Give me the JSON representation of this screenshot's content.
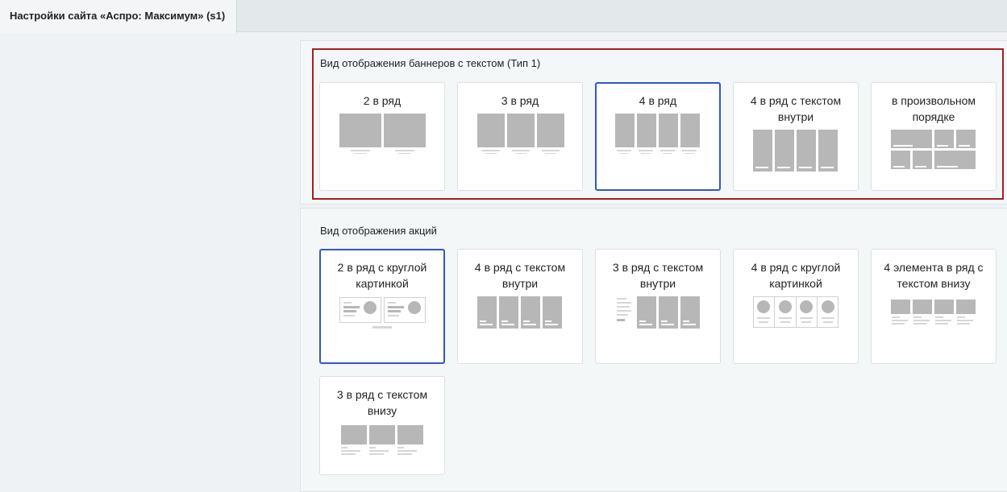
{
  "tab": {
    "title": "Настройки сайта «Аспро: Максимум» (s1)"
  },
  "banners_section": {
    "title": "Вид отображения баннеров с текстом (Тип 1)",
    "options": [
      {
        "label": "2 в ряд",
        "selected": false
      },
      {
        "label": "3 в ряд",
        "selected": false
      },
      {
        "label": "4 в ряд",
        "selected": true
      },
      {
        "label": "4 в ряд с текстом внутри",
        "selected": false
      },
      {
        "label": "в произвольном порядке",
        "selected": false
      }
    ]
  },
  "sales_section": {
    "title": "Вид отображения акций",
    "options": [
      {
        "label": "2 в ряд с круглой картинкой",
        "selected": true
      },
      {
        "label": "4 в ряд с текстом внутри",
        "selected": false
      },
      {
        "label": "3 в ряд с текстом внутри",
        "selected": false
      },
      {
        "label": "4 в ряд с круглой картинкой",
        "selected": false
      },
      {
        "label": "4 элемента в ряд с текстом внизу",
        "selected": false
      },
      {
        "label": "3 в ряд с текстом внизу",
        "selected": false
      }
    ]
  },
  "colors": {
    "selected_border": "#3555c5",
    "highlight_border": "#a51d24",
    "thumb_gray": "#b7b7b7"
  }
}
